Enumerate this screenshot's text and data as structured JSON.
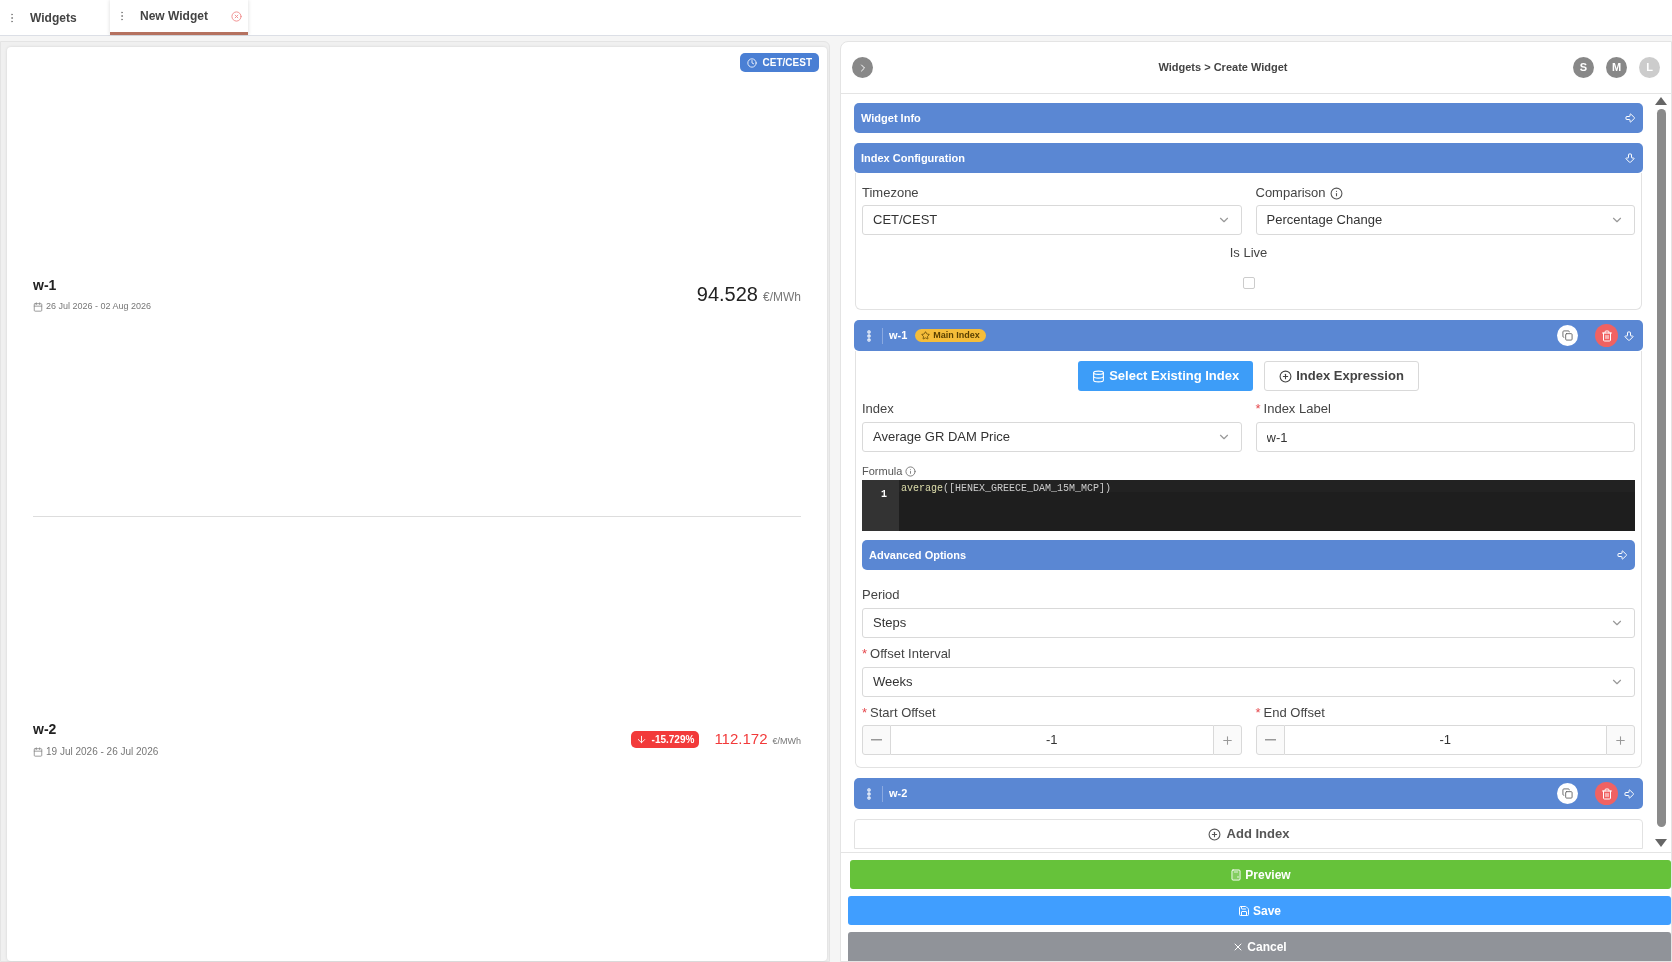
{
  "tabs": [
    {
      "label": "Widgets",
      "selected": false,
      "closable": false
    },
    {
      "label": "New Widget",
      "selected": true,
      "closable": true
    }
  ],
  "preview": {
    "timezone_badge": "CET/CEST",
    "items": [
      {
        "name": "w-1",
        "date_range": "26 Jul 2026 - 02 Aug 2026",
        "value": "94.528",
        "unit": "€/MWh",
        "falling": false
      },
      {
        "name": "w-2",
        "date_range": "19 Jul 2026 - 26 Jul 2026",
        "value": "112.172",
        "unit": "€/MWh",
        "falling": true,
        "change": "-15.729%"
      }
    ]
  },
  "editor": {
    "breadcrumb": "Widgets > Create Widget",
    "avatars": [
      {
        "letter": "S",
        "faded": false
      },
      {
        "letter": "M",
        "faded": false
      },
      {
        "letter": "L",
        "faded": true
      }
    ],
    "widget_info": {
      "title": "Widget Info",
      "expanded": false
    },
    "index_configuration": {
      "title": "Index Configuration",
      "expanded": true,
      "timezone": {
        "label": "Timezone",
        "value": "CET/CEST"
      },
      "comparison": {
        "label": "Comparison",
        "value": "Percentage Change"
      },
      "is_live": {
        "label": "Is Live",
        "checked": false
      }
    },
    "indexes": [
      {
        "label": "w-1",
        "badge": "Main Index",
        "expanded": true,
        "modes": [
          {
            "label": "Select Existing Index",
            "selected": true
          },
          {
            "label": "Index Expression",
            "selected": false
          }
        ],
        "index": {
          "label": "Index",
          "value": "Average GR DAM Price"
        },
        "index_label": {
          "label": "Index Label",
          "required_mark": "*",
          "value": "w-1"
        },
        "formula": {
          "label": "Formula",
          "line_number": "1",
          "function": "average",
          "args": "([HENEX_GREECE_DAM_15M_MCP])"
        },
        "advanced_options": {
          "title": "Advanced Options",
          "expanded": false
        },
        "period": {
          "label": "Period",
          "value": "Steps"
        },
        "offset_interval": {
          "label": "Offset Interval",
          "required_mark": "*",
          "value": "Weeks"
        },
        "start_offset": {
          "label": "Start Offset",
          "required_mark": "*",
          "value": "-1"
        },
        "end_offset": {
          "label": "End Offset",
          "required_mark": "*",
          "value": "-1"
        }
      },
      {
        "label": "w-2",
        "expanded": false
      }
    ],
    "add_index": "Add Index",
    "buttons": [
      {
        "kind": "preview",
        "label": "Preview"
      },
      {
        "kind": "save",
        "label": "Save"
      },
      {
        "kind": "cancel",
        "label": "Cancel"
      }
    ]
  }
}
